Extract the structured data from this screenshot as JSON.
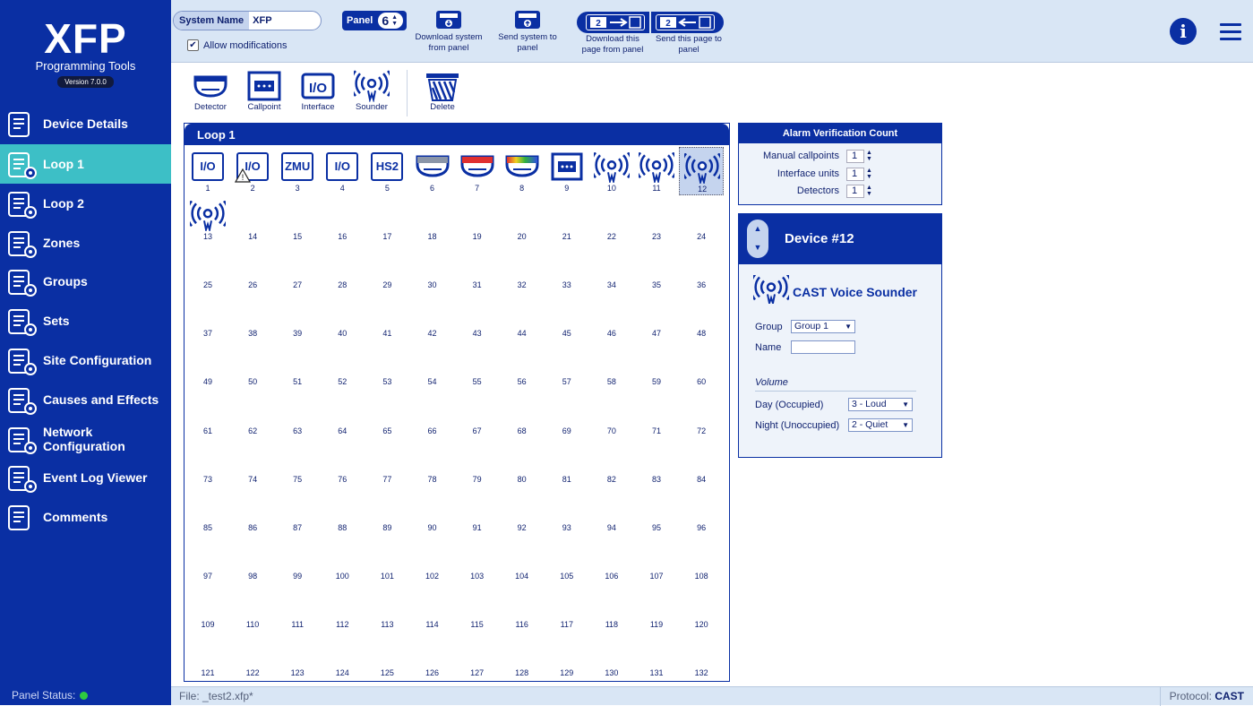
{
  "app": {
    "brand": "XFP",
    "subtitle": "Programming Tools",
    "version": "Version 7.0.0"
  },
  "sidebar": {
    "items": [
      {
        "label": "Device Details",
        "icon": "device-details-icon"
      },
      {
        "label": "Loop 1",
        "icon": "loop-icon",
        "active": true
      },
      {
        "label": "Loop 2",
        "icon": "loop-icon"
      },
      {
        "label": "Zones",
        "icon": "zones-icon"
      },
      {
        "label": "Groups",
        "icon": "groups-icon"
      },
      {
        "label": "Sets",
        "icon": "sets-icon"
      },
      {
        "label": "Site Configuration",
        "icon": "site-configuration-icon"
      },
      {
        "label": "Causes and Effects",
        "icon": "causes-effects-icon"
      },
      {
        "label": "Network Configuration",
        "icon": "network-configuration-icon"
      },
      {
        "label": "Event Log Viewer",
        "icon": "event-log-icon"
      },
      {
        "label": "Comments",
        "icon": "comments-icon"
      }
    ],
    "panel_status_label": "Panel Status:",
    "panel_status_color": "#2ecc40"
  },
  "toolbar": {
    "system_name_label": "System Name",
    "system_name_value": "XFP",
    "allow_modifications": "Allow modifications",
    "allow_modifications_checked": true,
    "panel_label": "Panel",
    "panel_value": "6",
    "download_system": "Download system from panel",
    "send_system": "Send system to panel",
    "page_number": "2",
    "download_page": "Download this page from panel",
    "send_page": "Send this page to panel"
  },
  "device_tools": [
    {
      "label": "Detector"
    },
    {
      "label": "Callpoint"
    },
    {
      "label": "Interface",
      "text": "I/O"
    },
    {
      "label": "Sounder"
    },
    {
      "label": "Delete"
    }
  ],
  "loop": {
    "title": "Loop 1",
    "devices": [
      {
        "n": "1",
        "type": "io",
        "text": "I/O"
      },
      {
        "n": "2",
        "type": "io",
        "text": "I/O",
        "warning": true
      },
      {
        "n": "3",
        "type": "io",
        "text": "ZMU"
      },
      {
        "n": "4",
        "type": "io",
        "text": "I/O"
      },
      {
        "n": "5",
        "type": "io",
        "text": "HS2"
      },
      {
        "n": "6",
        "type": "detector",
        "color": "#8a95a8"
      },
      {
        "n": "7",
        "type": "detector",
        "color": "#e03030"
      },
      {
        "n": "8",
        "type": "detector",
        "color": "multi"
      },
      {
        "n": "9",
        "type": "callpoint"
      },
      {
        "n": "10",
        "type": "sounder"
      },
      {
        "n": "11",
        "type": "sounder"
      },
      {
        "n": "12",
        "type": "sounder",
        "selected": true
      },
      {
        "n": "13",
        "type": "sounder"
      }
    ],
    "total": 132
  },
  "alarm_verification": {
    "title": "Alarm Verification Count",
    "rows": [
      {
        "label": "Manual callpoints",
        "value": "1"
      },
      {
        "label": "Interface units",
        "value": "1"
      },
      {
        "label": "Detectors",
        "value": "1"
      }
    ]
  },
  "device_panel": {
    "title": "Device #12",
    "device_name": "CAST Voice Sounder",
    "group_label": "Group",
    "group_value": "Group 1",
    "name_label": "Name",
    "name_value": "",
    "volume_label": "Volume",
    "day_label": "Day (Occupied)",
    "day_value": "3 - Loud",
    "night_label": "Night (Unoccupied)",
    "night_value": "2 - Quiet"
  },
  "footer": {
    "file": "File: _test2.xfp*",
    "protocol_label": "Protocol:",
    "protocol_value": "CAST"
  }
}
